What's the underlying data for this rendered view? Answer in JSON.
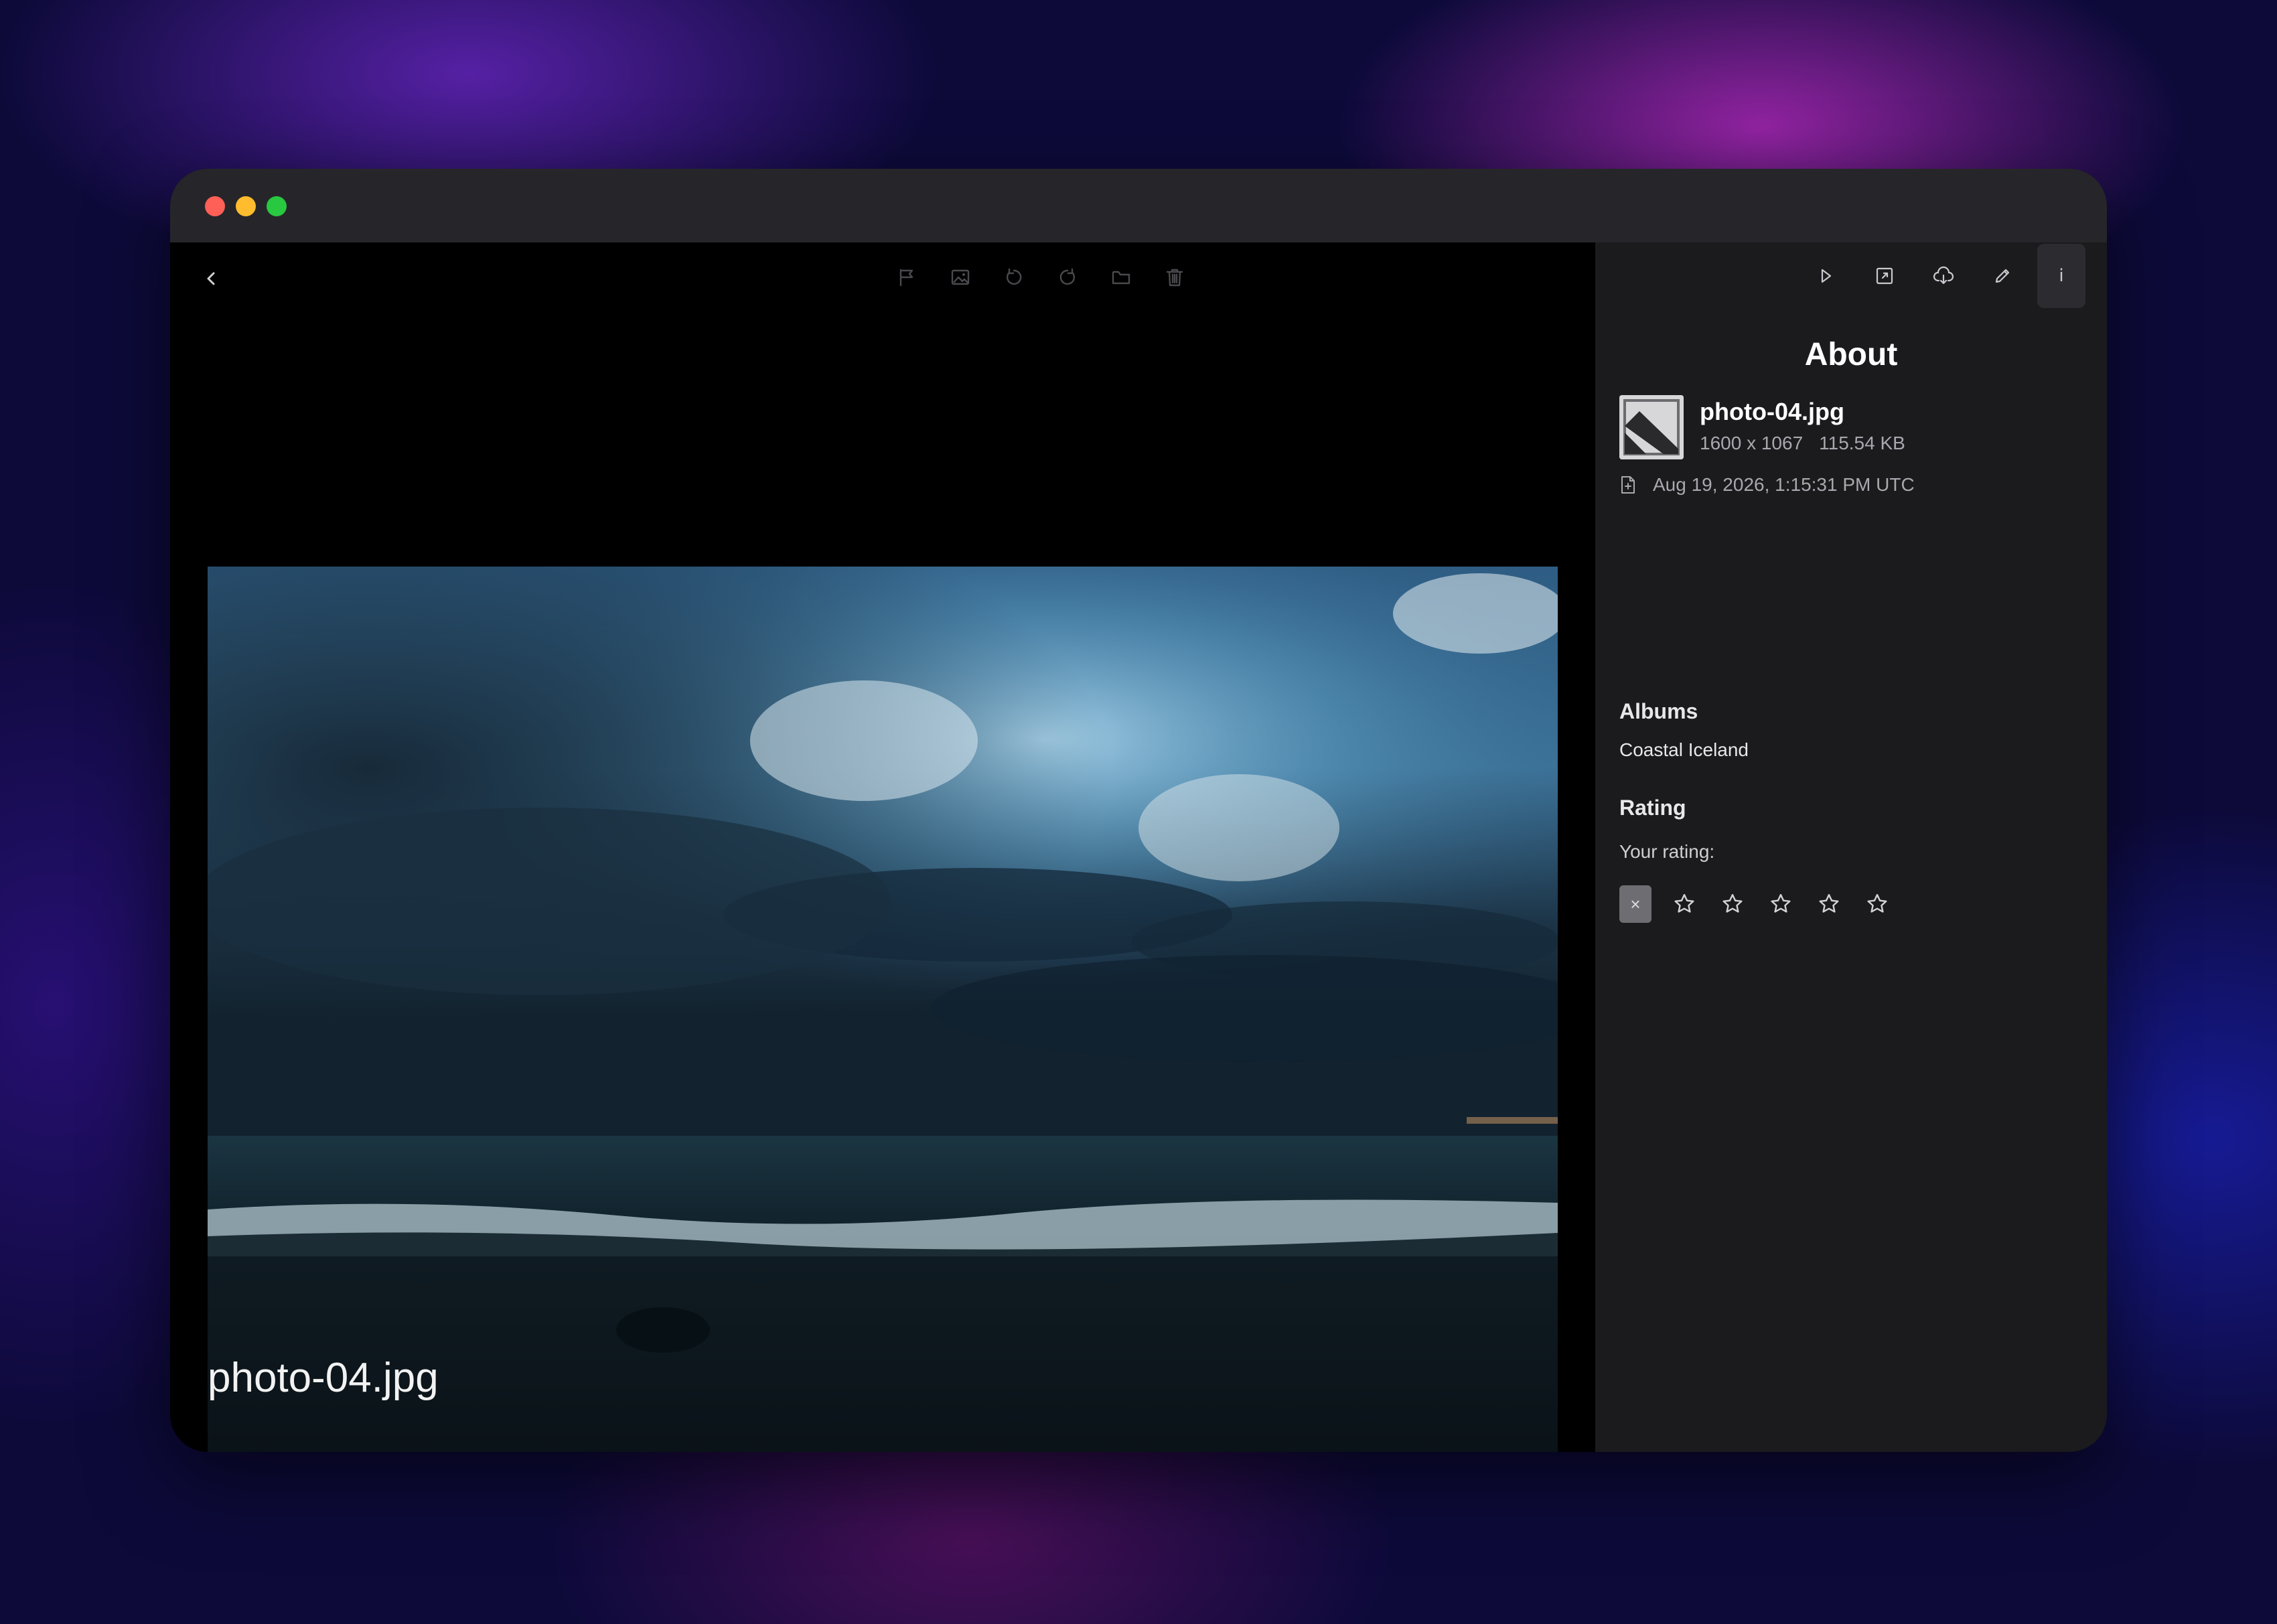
{
  "window": {
    "traffic_lights": {
      "close_color": "#fe5f57",
      "minimize_color": "#febc2e",
      "zoom_color": "#28c840"
    }
  },
  "viewer": {
    "back_icon": "chevron-left-icon",
    "toolbar_icons": [
      "flag-icon",
      "image-icon",
      "rotate-left-icon",
      "rotate-right-icon",
      "folder-icon",
      "trash-icon"
    ],
    "caption": "photo-04.jpg"
  },
  "panel": {
    "action_icons": [
      "play-icon",
      "expand-icon",
      "cloud-download-icon",
      "pencil-icon",
      "info-icon"
    ],
    "info_glyph": "i",
    "title": "About",
    "file_name": "photo-04.jpg",
    "dimensions": "1600 x 1067",
    "file_size": "115.54 KB",
    "date": "Aug 19, 2026, 1:15:31 PM UTC",
    "albums_heading": "Albums",
    "album": "Coastal Iceland",
    "rating_heading": "Rating",
    "rating_label": "Your rating:",
    "clear_glyph": "×",
    "rating_value": 0,
    "rating_max": 5
  }
}
